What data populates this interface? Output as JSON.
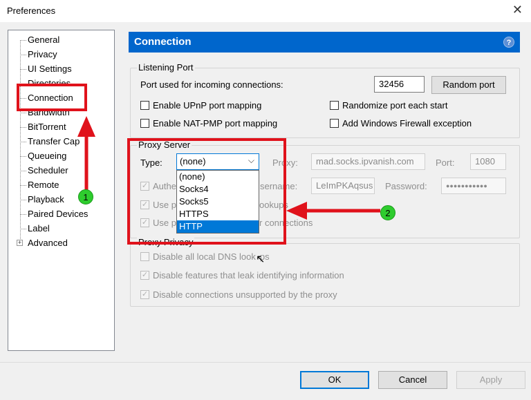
{
  "window": {
    "title": "Preferences",
    "close_glyph": "✕"
  },
  "sidebar": {
    "items": [
      {
        "label": "General"
      },
      {
        "label": "Privacy"
      },
      {
        "label": "UI Settings"
      },
      {
        "label": "Directories"
      },
      {
        "label": "Connection"
      },
      {
        "label": "Bandwidth"
      },
      {
        "label": "BitTorrent"
      },
      {
        "label": "Transfer Cap"
      },
      {
        "label": "Queueing"
      },
      {
        "label": "Scheduler"
      },
      {
        "label": "Remote"
      },
      {
        "label": "Playback"
      },
      {
        "label": "Paired Devices"
      },
      {
        "label": "Label"
      },
      {
        "label": "Advanced"
      }
    ],
    "expander_glyph": "+"
  },
  "panel": {
    "title": "Connection",
    "help_glyph": "?",
    "listening": {
      "legend": "Listening Port",
      "port_label": "Port used for incoming connections:",
      "port_value": "32456",
      "random_port": "Random port",
      "upnp": "Enable UPnP port mapping",
      "natpmp": "Enable NAT-PMP port mapping",
      "randomize": "Randomize port each start",
      "firewall": "Add Windows Firewall exception"
    },
    "proxy": {
      "legend": "Proxy Server",
      "type_label": "Type:",
      "type_value": "(none)",
      "type_options": [
        "(none)",
        "Socks4",
        "Socks5",
        "HTTPS",
        "HTTP"
      ],
      "proxy_label": "Proxy:",
      "proxy_value": "mad.socks.ipvanish.com",
      "port_label": "Port:",
      "port_value": "1080",
      "auth_visible": "Authe",
      "username_visible": "sername:",
      "username_value": "LeImPKAqsus",
      "password_label": "Password:",
      "password_value": "●●●●●●●●●●●",
      "use_p1_a": "Use pr",
      "use_p1_b": "ookups",
      "use_p2_a": "Use p",
      "use_p2_b": "r connections"
    },
    "privacy": {
      "legend": "Proxy Privacy",
      "dns_a": "Disable all local DNS look",
      "dns_b": "ps",
      "leak": "Disable features that leak identifying information",
      "unsupported": "Disable connections unsupported by the proxy"
    }
  },
  "footer": {
    "ok": "OK",
    "cancel": "Cancel",
    "apply": "Apply"
  },
  "annotations": {
    "badge1": "1",
    "badge2": "2",
    "color": "#e0121b",
    "badge_color": "#2ecc2e"
  }
}
